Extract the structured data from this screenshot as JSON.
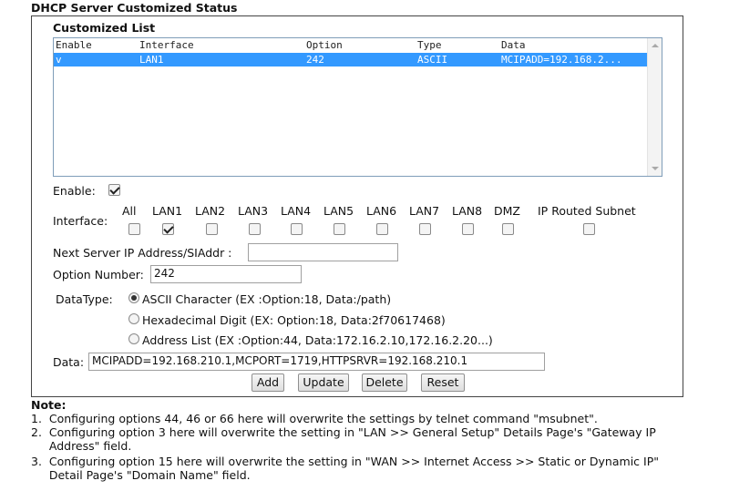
{
  "page": {
    "title": "DHCP Server Customized Status"
  },
  "list": {
    "heading": "Customized List",
    "columns": [
      "Enable",
      "Interface",
      "Option",
      "Type",
      "Data"
    ],
    "rows": [
      {
        "enable": "v",
        "interface": "LAN1",
        "option": "242",
        "type": "ASCII",
        "data": "MCIPADD=192.168.2..."
      }
    ]
  },
  "form": {
    "enable_label": "Enable:",
    "enable_checked": true,
    "interface_label": "Interface:",
    "interfaces": [
      {
        "label": "All",
        "checked": false
      },
      {
        "label": "LAN1",
        "checked": true
      },
      {
        "label": "LAN2",
        "checked": false
      },
      {
        "label": "LAN3",
        "checked": false
      },
      {
        "label": "LAN4",
        "checked": false
      },
      {
        "label": "LAN5",
        "checked": false
      },
      {
        "label": "LAN6",
        "checked": false
      },
      {
        "label": "LAN7",
        "checked": false
      },
      {
        "label": "LAN8",
        "checked": false
      },
      {
        "label": "DMZ",
        "checked": false
      },
      {
        "label": "IP Routed Subnet",
        "checked": false
      }
    ],
    "next_server_label": "Next Server IP Address/SIAddr :",
    "next_server_value": "",
    "option_number_label": "Option Number:",
    "option_number_value": "242",
    "datatype_label": "DataType:",
    "datatypes": [
      {
        "label": "ASCII Character (EX :Option:18, Data:/path)",
        "selected": true
      },
      {
        "label": "Hexadecimal Digit (EX: Option:18, Data:2f70617468)",
        "selected": false
      },
      {
        "label": "Address List (EX :Option:44, Data:172.16.2.10,172.16.2.20...)",
        "selected": false
      }
    ],
    "data_label": "Data:",
    "data_value": "MCIPADD=192.168.210.1,MCPORT=1719,HTTPSRVR=192.168.210.1"
  },
  "buttons": {
    "add": "Add",
    "update": "Update",
    "delete": "Delete",
    "reset": "Reset"
  },
  "note": {
    "title": "Note:",
    "lines": [
      "1.  Configuring options 44, 46 or 66 here will overwrite the settings by telnet command \"msubnet\".",
      "2.  Configuring option 3 here will overwrite the setting in \"LAN >> General Setup\" Details Page's \"Gateway IP",
      "     Address\" field.",
      "3.  Configuring option 15 here will overwrite the setting in \"WAN >> Internet Access >> Static or Dynamic IP\"",
      "     Detail Page's \"Domain Name\" field."
    ]
  }
}
